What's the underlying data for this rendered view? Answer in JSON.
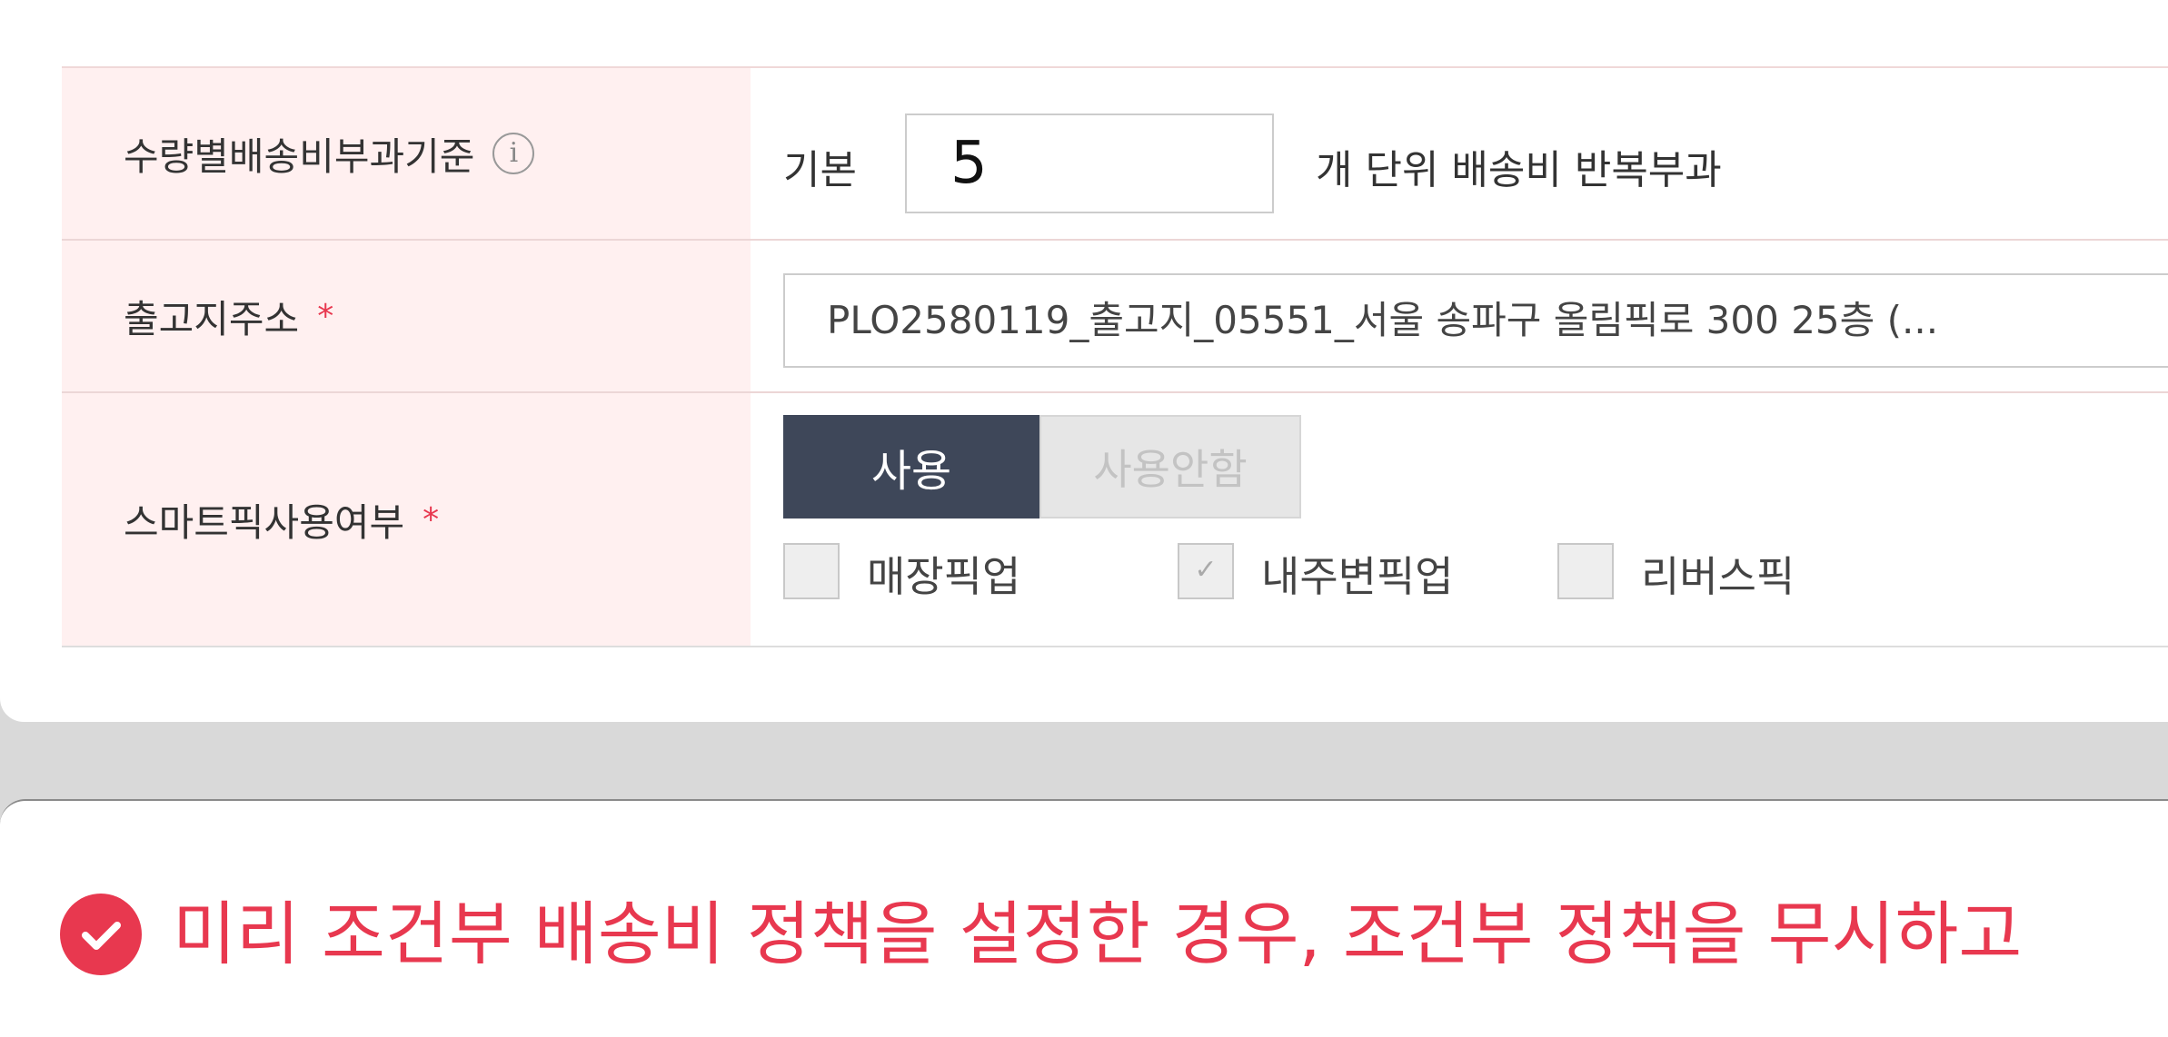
{
  "form": {
    "qty_rule": {
      "label": "수량별배송비부과기준",
      "prefix": "기본",
      "value": "5",
      "suffix": "개 단위 배송비 반복부과"
    },
    "origin_address": {
      "label": "출고지주소",
      "selected": "PLO2580119_출고지_05551_서울 송파구 올림픽로 300 25층 (..."
    },
    "smart_pick": {
      "label": "스마트픽사용여부",
      "toggle_on": "사용",
      "toggle_off": "사용안함",
      "options": [
        {
          "label": "매장픽업",
          "checked": false
        },
        {
          "label": "내주변픽업",
          "checked": true
        },
        {
          "label": "리버스픽",
          "checked": false
        }
      ]
    },
    "required_mark": "*"
  },
  "notice": {
    "text": "미리 조건부 배송비 정책을 설정한 경우, 조건부 정책을 무시하고"
  },
  "colors": {
    "accent_red": "#e8384f",
    "header_bg": "#fff0f0",
    "toggle_active": "#3e4759"
  },
  "icons": [
    "info-icon",
    "chevron-down-icon",
    "check-circle-icon",
    "check-icon"
  ]
}
